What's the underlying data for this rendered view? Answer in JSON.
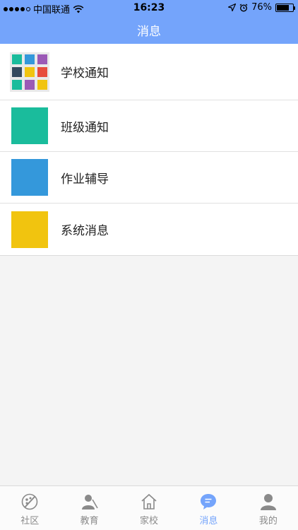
{
  "status_bar": {
    "carrier": "中国联通",
    "time": "16:23",
    "battery": "76%",
    "battery_level": 0.76
  },
  "header": {
    "title": "消息"
  },
  "messages": [
    {
      "label": "学校通知",
      "icon": "grid-icon"
    },
    {
      "label": "班级通知",
      "icon_color": "#1abc9c"
    },
    {
      "label": "作业辅导",
      "icon_color": "#3498db"
    },
    {
      "label": "系统消息",
      "icon_color": "#f1c40f"
    }
  ],
  "grid_icon_colors": [
    "#1abc9c",
    "#3498db",
    "#9b59b6",
    "#34495e",
    "#f1c40f",
    "#e74c3c",
    "#1abc9c",
    "#9b59b6",
    "#f1c40f"
  ],
  "tabs": [
    {
      "label": "社区",
      "icon": "community-icon",
      "active": false
    },
    {
      "label": "教育",
      "icon": "education-icon",
      "active": false
    },
    {
      "label": "家校",
      "icon": "home-school-icon",
      "active": false
    },
    {
      "label": "消息",
      "icon": "message-icon",
      "active": true
    },
    {
      "label": "我的",
      "icon": "profile-icon",
      "active": false
    }
  ],
  "colors": {
    "accent": "#74a4fb",
    "inactive": "#8a8a8a"
  }
}
